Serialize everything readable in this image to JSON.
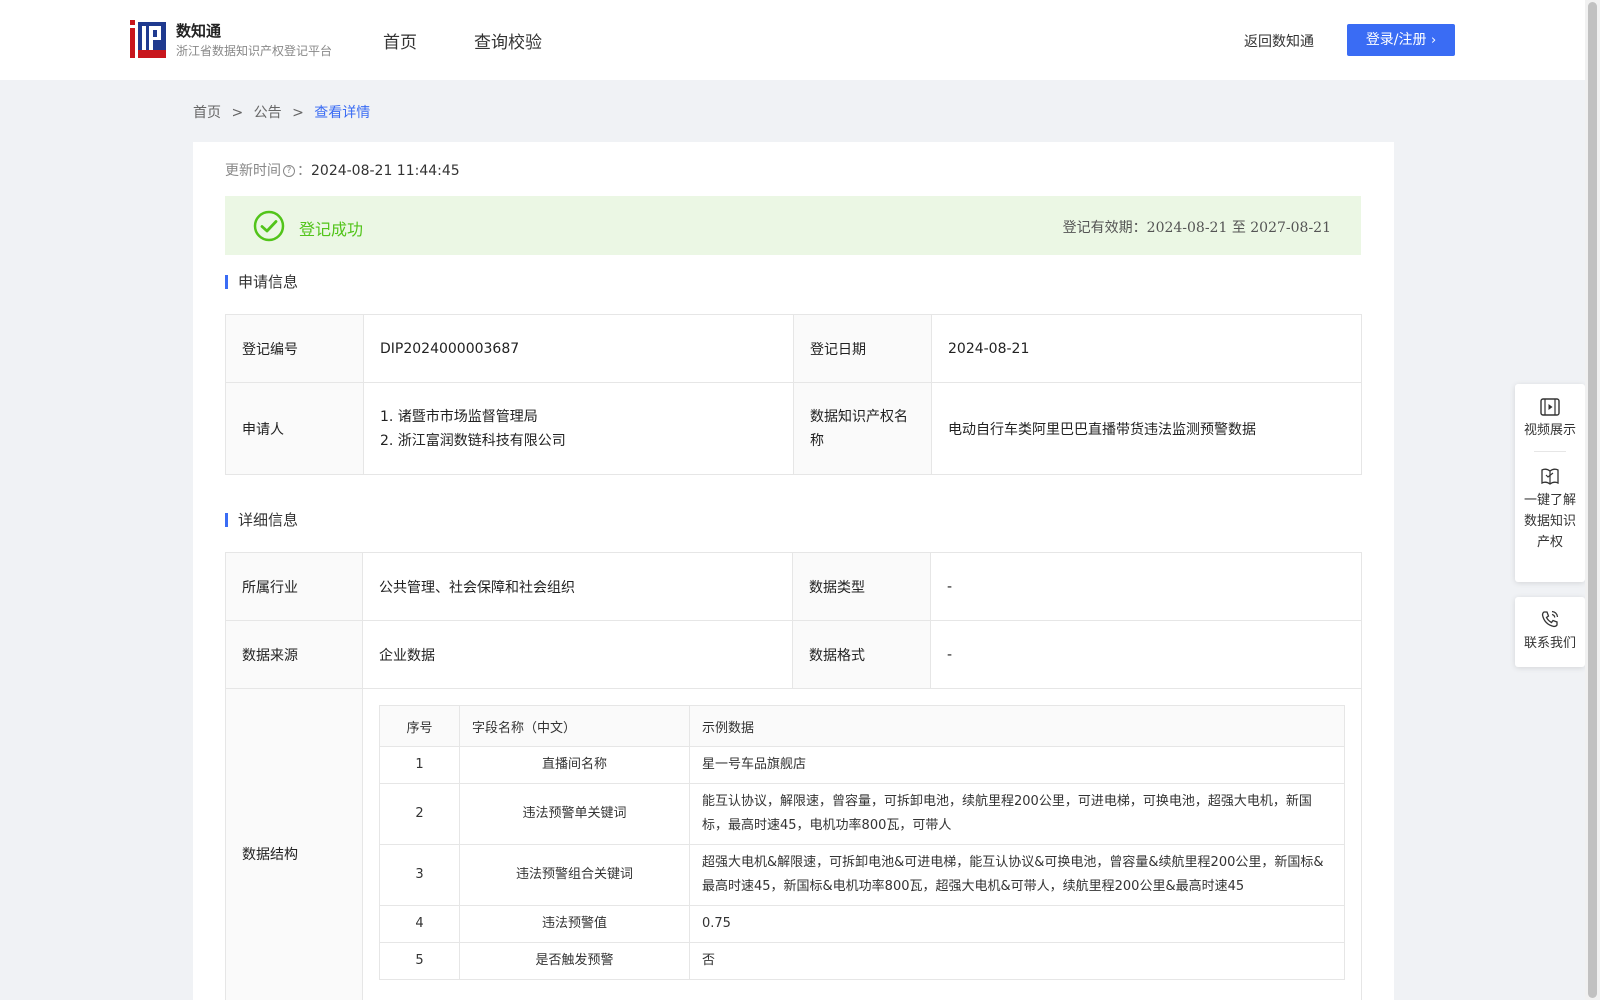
{
  "header": {
    "logo_name": "数知通",
    "logo_sub": "浙江省数据知识产权登记平台",
    "nav": [
      "首页",
      "查询校验"
    ],
    "back_link": "返回数知通",
    "login": "登录/注册"
  },
  "breadcrumb": [
    "首页",
    ">",
    "公告",
    ">",
    "查看详情"
  ],
  "update": {
    "label": "更新时间",
    "value": "2024-08-21 11:44:45"
  },
  "status": {
    "text": "登记成功",
    "validity_label": "登记有效期：",
    "validity_value": "2024-08-21 至 2027-08-21"
  },
  "sections": {
    "apply": "申请信息",
    "detail": "详细信息"
  },
  "apply": {
    "reg_no_label": "登记编号",
    "reg_no": "DIP2024000003687",
    "reg_date_label": "登记日期",
    "reg_date": "2024-08-21",
    "applicant_label": "申请人",
    "applicant_1": "1. 诸暨市市场监督管理局",
    "applicant_2": "2. 浙江富润数链科技有限公司",
    "ip_name_label": "数据知识产权名称",
    "ip_name": "电动自行车类阿里巴巴直播带货违法监测预警数据"
  },
  "detail": {
    "industry_label": "所属行业",
    "industry": "公共管理、社会保障和社会组织",
    "type_label": "数据类型",
    "type": "-",
    "source_label": "数据来源",
    "source": "企业数据",
    "format_label": "数据格式",
    "format": "-",
    "structure_label": "数据结构"
  },
  "structure": {
    "headers": [
      "序号",
      "字段名称（中文）",
      "示例数据"
    ],
    "rows": [
      {
        "no": "1",
        "field": "直播间名称",
        "sample": "星一号车品旗舰店"
      },
      {
        "no": "2",
        "field": "违法预警单关键词",
        "sample": "能互认协议，解限速，曾容量，可拆卸电池，续航里程200公里，可进电梯，可换电池，超强大电机，新国标，最高时速45，电机功率800瓦，可带人"
      },
      {
        "no": "3",
        "field": "违法预警组合关键词",
        "sample": "超强大电机&解限速，可拆卸电池&可进电梯，能互认协议&可换电池，曾容量&续航里程200公里，新国标&最高时速45，新国标&电机功率800瓦，超强大电机&可带人，续航里程200公里&最高时速45"
      },
      {
        "no": "4",
        "field": "违法预警值",
        "sample": "0.75"
      },
      {
        "no": "5",
        "field": "是否触发预警",
        "sample": "否"
      }
    ]
  },
  "float_panel": {
    "video": "视频展示",
    "learn": "一键了解数据知识产权",
    "contact": "联系我们"
  },
  "colors": {
    "primary": "#3a6cf4",
    "success": "#52c41a",
    "success_bg": "#ebf7e4"
  }
}
